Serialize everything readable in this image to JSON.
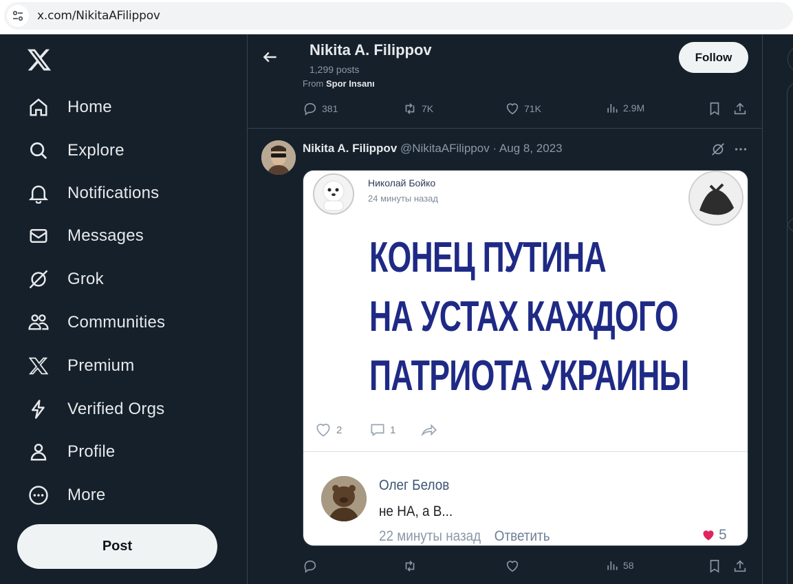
{
  "browser": {
    "url": "x.com/NikitaAFilippov"
  },
  "sidebar": {
    "items": [
      {
        "label": "Home",
        "icon": "home-icon"
      },
      {
        "label": "Explore",
        "icon": "search-icon"
      },
      {
        "label": "Notifications",
        "icon": "bell-icon"
      },
      {
        "label": "Messages",
        "icon": "envelope-icon"
      },
      {
        "label": "Grok",
        "icon": "grok-icon"
      },
      {
        "label": "Communities",
        "icon": "people-icon"
      },
      {
        "label": "Premium",
        "icon": "x-icon"
      },
      {
        "label": "Verified Orgs",
        "icon": "lightning-icon"
      },
      {
        "label": "Profile",
        "icon": "person-icon"
      },
      {
        "label": "More",
        "icon": "more-circle-icon"
      }
    ],
    "post_label": "Post"
  },
  "header": {
    "name": "Nikita A. Filippov",
    "post_count": "1,299 posts",
    "follow_label": "Follow"
  },
  "prev_tweet": {
    "from_prefix": "From",
    "from_source": "Spor Insanı",
    "replies": "381",
    "reposts": "7K",
    "likes": "71K",
    "views": "2.9M"
  },
  "tweet": {
    "author": "Nikita A. Filippov",
    "handle": "@NikitaAFilippov",
    "date": "Aug 8, 2023",
    "separator": "·",
    "views": "58",
    "media": {
      "post_author": "Николай Бойко",
      "post_time": "24 минуты назад",
      "lines": [
        "КОНЕЦ ПУТИНА",
        "НА УСТАХ КАЖДОГО",
        "ПАТРИОТА УКРАИНЫ"
      ],
      "likes": "2",
      "comments": "1",
      "comment_author": "Олег Белов",
      "comment_text": "не НА, а В...",
      "comment_time": "22 минуты назад",
      "comment_reply": "Ответить",
      "comment_likes": "5"
    }
  },
  "colors": {
    "background": "#15202b",
    "border": "#38444d",
    "muted_text": "#8b98a5",
    "poster_text": "#1f2a86",
    "heart": "#e0245e"
  }
}
